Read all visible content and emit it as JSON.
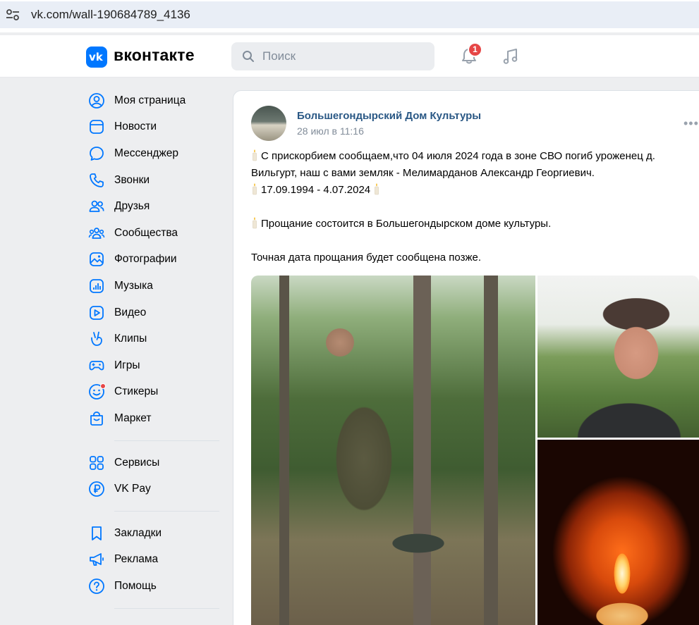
{
  "browser": {
    "url": "vk.com/wall-190684789_4136"
  },
  "header": {
    "logo_text": "вконтакте",
    "logo_mark": "vk",
    "search_placeholder": "Поиск",
    "notifications_count": "1",
    "brand_color": "#0077ff",
    "badge_color": "#e64646"
  },
  "sidebar": {
    "groups": [
      [
        {
          "label": "Моя страница",
          "icon": "profile-icon"
        },
        {
          "label": "Новости",
          "icon": "news-icon"
        },
        {
          "label": "Мессенджер",
          "icon": "message-icon"
        },
        {
          "label": "Звонки",
          "icon": "phone-icon"
        },
        {
          "label": "Друзья",
          "icon": "friends-icon"
        },
        {
          "label": "Сообщества",
          "icon": "communities-icon"
        },
        {
          "label": "Фотографии",
          "icon": "photos-icon"
        },
        {
          "label": "Музыка",
          "icon": "music-icon"
        },
        {
          "label": "Видео",
          "icon": "video-icon"
        },
        {
          "label": "Клипы",
          "icon": "clips-icon"
        },
        {
          "label": "Игры",
          "icon": "games-icon"
        },
        {
          "label": "Стикеры",
          "icon": "stickers-icon"
        },
        {
          "label": "Маркет",
          "icon": "market-icon"
        }
      ],
      [
        {
          "label": "Сервисы",
          "icon": "services-icon"
        },
        {
          "label": "VK Pay",
          "icon": "vkpay-icon"
        }
      ],
      [
        {
          "label": "Закладки",
          "icon": "bookmark-icon"
        },
        {
          "label": "Реклама",
          "icon": "ads-icon"
        },
        {
          "label": "Помощь",
          "icon": "help-icon"
        }
      ]
    ]
  },
  "post": {
    "author": "Большегондырский Дом Культуры",
    "date": "28 июл в 11:16",
    "more": "•••",
    "lines": [
      {
        "candle_start": true,
        "text": "С прискорбием сообщаем,что 04 июля 2024 года в зоне СВО погиб уроженец д. Вильгурт, наш с вами земляк - Мелимарданов Александр Георгиевич."
      },
      {
        "candle_start": true,
        "candle_end": true,
        "text": "17.09.1994 - 4.07.2024"
      },
      {
        "blank": true
      },
      {
        "candle_start": true,
        "text": "Прощание состоится в Большегондырском доме культуры."
      },
      {
        "blank": true
      },
      {
        "text": "Точная дата прощания будет сообщена позже."
      }
    ],
    "photos": [
      "photo-soldier-in-forest",
      "photo-man-in-cap",
      "photo-candle-in-hands"
    ]
  }
}
